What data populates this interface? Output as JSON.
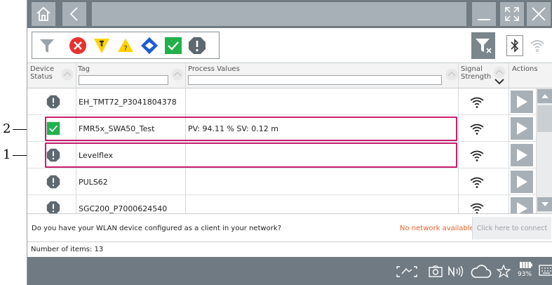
{
  "header": {
    "device_status": "Device\nStatus",
    "tag": "Tag",
    "process_values": "Process Values",
    "signal_strength": "Signal\nStrength",
    "actions": "Actions"
  },
  "rows": [
    {
      "tag": "EH_TMT72_P3041804378",
      "pv": "",
      "status": "warning"
    },
    {
      "tag": "FMR5x_SWA50_Test",
      "pv": "PV: 94.11 %  SV: 0.12 m",
      "status": "ok"
    },
    {
      "tag": "Levelflex",
      "pv": "",
      "status": "warning"
    },
    {
      "tag": "PULS62",
      "pv": "",
      "status": "warning"
    },
    {
      "tag": "SGC200_P7000624540",
      "pv": "",
      "status": "warning"
    }
  ],
  "message": {
    "question": "Do you have your WLAN device configured as a client in your network?",
    "status": "No network available.",
    "connect": "Click here to connect"
  },
  "count": "Number of items: 13",
  "battery": "93%",
  "callouts": [
    "2",
    "1"
  ],
  "colors": {
    "highlight": "#c81e6e",
    "ok": "#22b14c",
    "warning": "#5d6870",
    "error": "#e8312f",
    "maintenance": "#ffd200",
    "check": "#1e5bd6"
  }
}
